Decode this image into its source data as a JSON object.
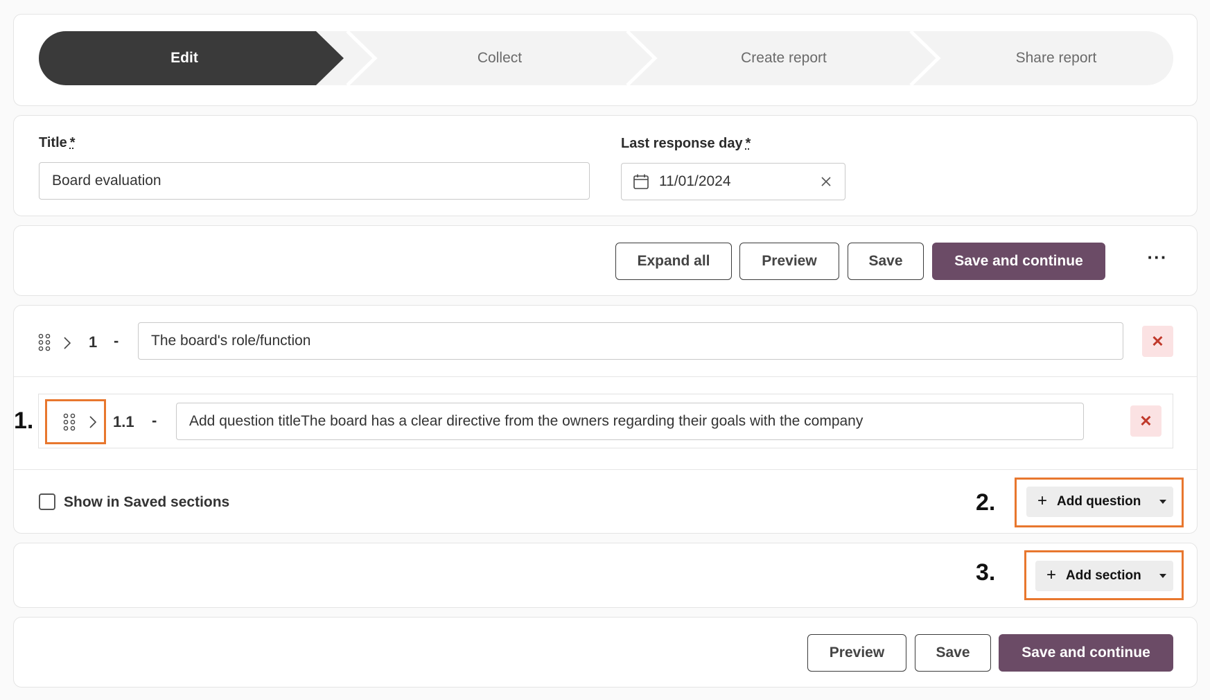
{
  "stepper": {
    "steps": [
      {
        "label": "Edit",
        "active": true
      },
      {
        "label": "Collect",
        "active": false
      },
      {
        "label": "Create report",
        "active": false
      },
      {
        "label": "Share report",
        "active": false
      }
    ],
    "active_color": "#3a3a3a",
    "inactive_color": "#f3f3f3"
  },
  "form": {
    "title_label": "Title",
    "title_required_mark": "*",
    "title_value": "Board evaluation",
    "date_label": "Last response day",
    "date_required_mark": "*",
    "date_value": "11/01/2024"
  },
  "toolbar": {
    "expand_all": "Expand all",
    "preview": "Preview",
    "save": "Save",
    "save_continue": "Save and continue",
    "more": "···"
  },
  "section": {
    "number": "1",
    "dash": "-",
    "title_value": "The board's role/function",
    "delete_glyph": "✕",
    "question": {
      "number": "1.1",
      "dash": "-",
      "title_value": "Add question titleThe board has a clear directive from the owners regarding their goals with the company",
      "delete_glyph": "✕"
    },
    "show_saved_label": "Show in Saved sections",
    "show_saved_checked": false,
    "add_question": "Add question"
  },
  "add_section": {
    "label": "Add section"
  },
  "footer": {
    "preview": "Preview",
    "save": "Save",
    "save_continue": "Save and continue"
  },
  "annotations": {
    "one": "1.",
    "two": "2.",
    "three": "3.",
    "highlight_color": "#e8772e"
  },
  "colors": {
    "primary": "#6b4b66",
    "delete_bg": "#fbe2e3",
    "delete_fg": "#c0392b"
  }
}
